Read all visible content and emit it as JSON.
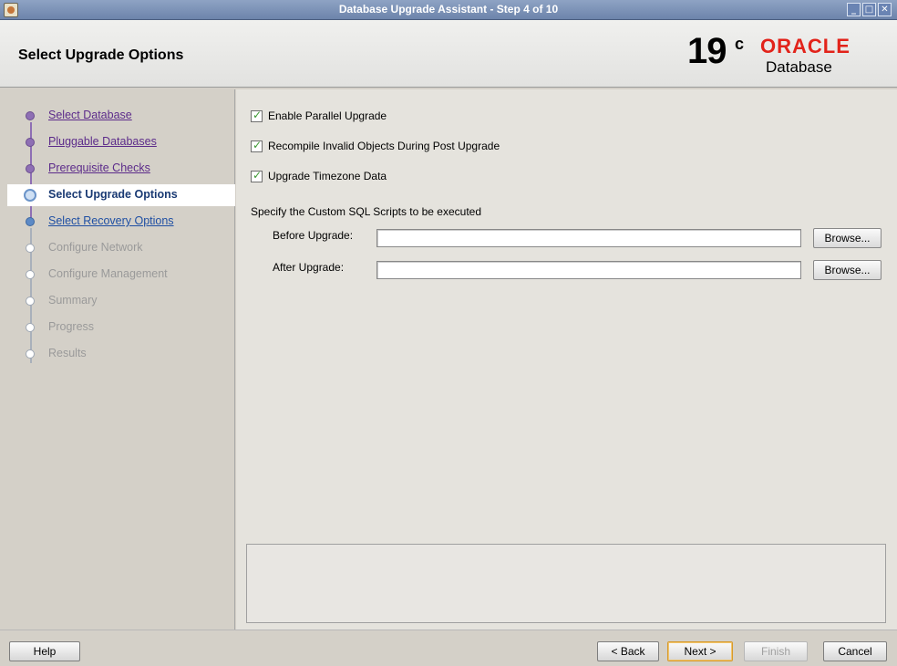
{
  "window": {
    "title": "Database Upgrade Assistant - Step 4 of 10"
  },
  "header": {
    "page_title": "Select Upgrade Options",
    "brand_version": "19",
    "brand_version_suffix": "c",
    "brand_name": "ORACLE",
    "brand_product": "Database"
  },
  "steps": [
    {
      "label": "Select Database",
      "state": "done"
    },
    {
      "label": "Pluggable Databases",
      "state": "done"
    },
    {
      "label": "Prerequisite Checks",
      "state": "done"
    },
    {
      "label": "Select Upgrade Options",
      "state": "current"
    },
    {
      "label": "Select Recovery Options",
      "state": "next"
    },
    {
      "label": "Configure Network",
      "state": "future"
    },
    {
      "label": "Configure Management",
      "state": "future"
    },
    {
      "label": "Summary",
      "state": "future"
    },
    {
      "label": "Progress",
      "state": "future"
    },
    {
      "label": "Results",
      "state": "future"
    }
  ],
  "options": {
    "parallel": {
      "label": "Enable Parallel Upgrade",
      "checked": true
    },
    "recompile": {
      "label": "Recompile Invalid Objects During Post Upgrade",
      "checked": true
    },
    "timezone": {
      "label": "Upgrade Timezone Data",
      "checked": true
    }
  },
  "scripts": {
    "section_label": "Specify the Custom SQL Scripts to be executed",
    "before_label": "Before Upgrade:",
    "before_value": "",
    "after_label": "After Upgrade:",
    "after_value": "",
    "browse_label": "Browse..."
  },
  "footer": {
    "help": "Help",
    "back": "< Back",
    "next": "Next >",
    "finish": "Finish",
    "cancel": "Cancel"
  },
  "colors": {
    "oracle_red": "#e2231a",
    "done_step": "#5c2b8a",
    "next_step": "#1f4fa3",
    "check_green": "#3c9a33"
  }
}
